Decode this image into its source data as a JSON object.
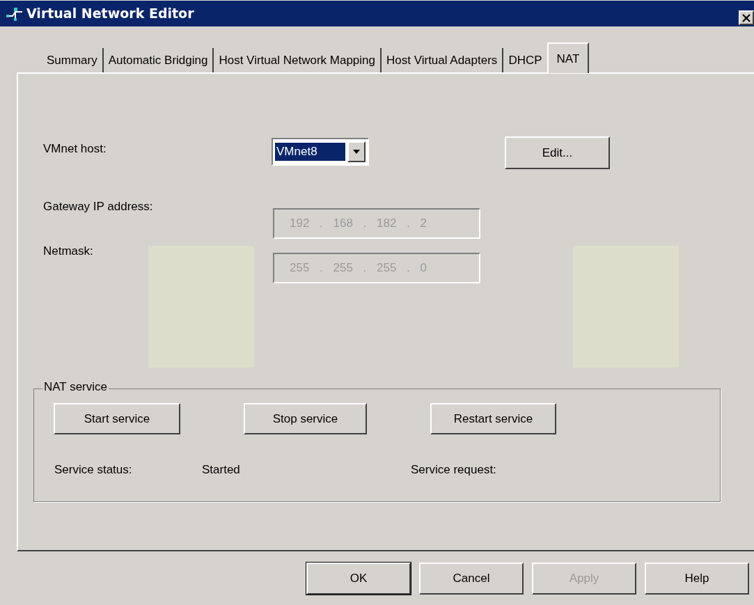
{
  "window": {
    "title": "Virtual Network Editor"
  },
  "tabs": [
    {
      "label": "Summary",
      "selected": false
    },
    {
      "label": "Automatic Bridging",
      "selected": false
    },
    {
      "label": "Host Virtual Network Mapping",
      "selected": false
    },
    {
      "label": "Host Virtual Adapters",
      "selected": false
    },
    {
      "label": "DHCP",
      "selected": false
    },
    {
      "label": "NAT",
      "selected": true
    }
  ],
  "vmnet_host": {
    "label": "VMnet host:",
    "value": "VMnet8"
  },
  "edit_button": {
    "label": "Edit..."
  },
  "gateway": {
    "label": "Gateway IP address:",
    "value": "192 . 168 . 182 . 2",
    "disabled": true
  },
  "netmask": {
    "label": "Netmask:",
    "value": "255 . 255 . 255 . 0",
    "disabled": true
  },
  "nat_service": {
    "title": "NAT service",
    "buttons": [
      "Start service",
      "Stop service",
      "Restart service"
    ],
    "status_label": "Service status:",
    "status_value": "Started",
    "request_label": "Service request:"
  },
  "buttons": [
    {
      "label": "OK",
      "default": true,
      "disabled": false
    },
    {
      "label": "Cancel",
      "default": false,
      "disabled": false
    },
    {
      "label": "Apply",
      "default": false,
      "disabled": true
    },
    {
      "label": "Help",
      "default": false,
      "disabled": false
    }
  ]
}
